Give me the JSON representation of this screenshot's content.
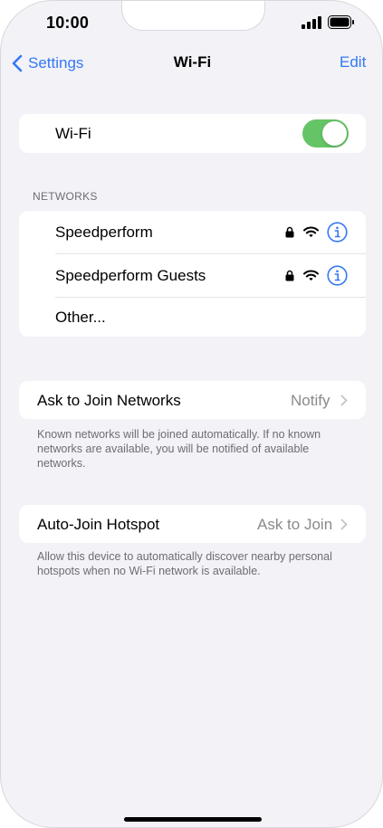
{
  "status_bar": {
    "time": "10:00"
  },
  "nav": {
    "back_label": "Settings",
    "title": "Wi-Fi",
    "edit_label": "Edit"
  },
  "wifi": {
    "label": "Wi-Fi",
    "enabled": true
  },
  "networks": {
    "header": "NETWORKS",
    "items": [
      {
        "name": "Speedperform",
        "secured": true
      },
      {
        "name": "Speedperform Guests",
        "secured": true
      },
      {
        "name": "Other..."
      }
    ]
  },
  "ask_to_join": {
    "label": "Ask to Join Networks",
    "value": "Notify",
    "footnote": "Known networks will be joined automatically. If no known networks are available, you will be notified of available networks."
  },
  "auto_join": {
    "label": "Auto-Join Hotspot",
    "value": "Ask to Join",
    "footnote": "Allow this device to automatically discover nearby personal hotspots when no Wi-Fi network is available."
  },
  "colors": {
    "accent": "#3478f6",
    "toggle_on": "#65c466",
    "background": "#f2f2f7",
    "secondary_text": "#8a8a8e"
  },
  "icons": {
    "back": "chevron-left-icon",
    "lock": "lock-icon",
    "wifi": "wifi-signal-icon",
    "info": "info-circle-icon",
    "chevron": "chevron-right-icon"
  }
}
